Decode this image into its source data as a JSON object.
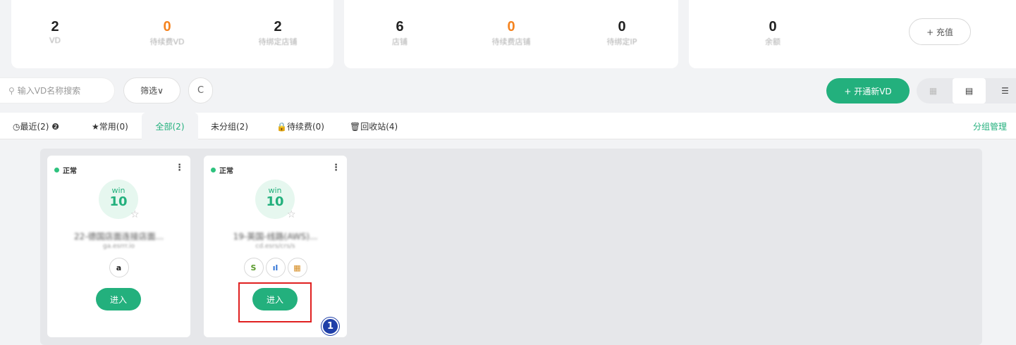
{
  "stats_panel_1": [
    {
      "value": "2",
      "label": "VD",
      "color": "dark"
    },
    {
      "value": "0",
      "label": "待续费VD",
      "color": "orange"
    },
    {
      "value": "2",
      "label": "待绑定店铺",
      "color": "dark"
    }
  ],
  "stats_panel_2": [
    {
      "value": "6",
      "label": "店铺",
      "color": "dark"
    },
    {
      "value": "0",
      "label": "待续费店铺",
      "color": "orange"
    },
    {
      "value": "0",
      "label": "待绑定IP",
      "color": "dark"
    }
  ],
  "stats_panel_3": {
    "value": "0",
    "label": "余额",
    "recharge_label": "+ 充值"
  },
  "toolbar": {
    "search_placeholder": "输入VD名称搜索",
    "filter_label": "筛选∨",
    "refresh_icon": "C",
    "new_vd_label": "+ 开通新VD",
    "view_icons": [
      "grid-view-icon",
      "card-view-icon",
      "list-view-icon"
    ]
  },
  "tabs": [
    {
      "label": "◷最近(2) ❷"
    },
    {
      "label": "★常用(0)"
    },
    {
      "label": "全部(2)"
    },
    {
      "label": "未分组(2)"
    },
    {
      "label": "🔒待续费(0)"
    },
    {
      "label": "🗑回收站(4)"
    }
  ],
  "group_manage_label": "分组管理",
  "cards": [
    {
      "status": "正常",
      "os_name": "win",
      "os_version": "10",
      "name": "22-德国店面连接店面...",
      "sub": "ga.esrrr.io",
      "platforms": [
        {
          "icon": "amazon-icon",
          "glyph": "a",
          "color": "#222"
        }
      ],
      "enter_label": "进入"
    },
    {
      "status": "正常",
      "os_name": "win",
      "os_version": "10",
      "name": "19-英国-线路(AWS)...",
      "sub": "cd.esrs/crs/s",
      "platforms": [
        {
          "icon": "shopify-icon",
          "glyph": "S",
          "color": "#5a9a2d"
        },
        {
          "icon": "analytics-icon",
          "glyph": "ıl",
          "color": "#2b6fd4"
        },
        {
          "icon": "shop-icon",
          "glyph": "▦",
          "color": "#d4891b"
        }
      ],
      "enter_label": "进入"
    }
  ],
  "step_badge": "1",
  "colors": {
    "accent": "#23b07d",
    "orange": "#f5831f",
    "highlight": "#e02020",
    "badge": "#1f3fa8"
  }
}
